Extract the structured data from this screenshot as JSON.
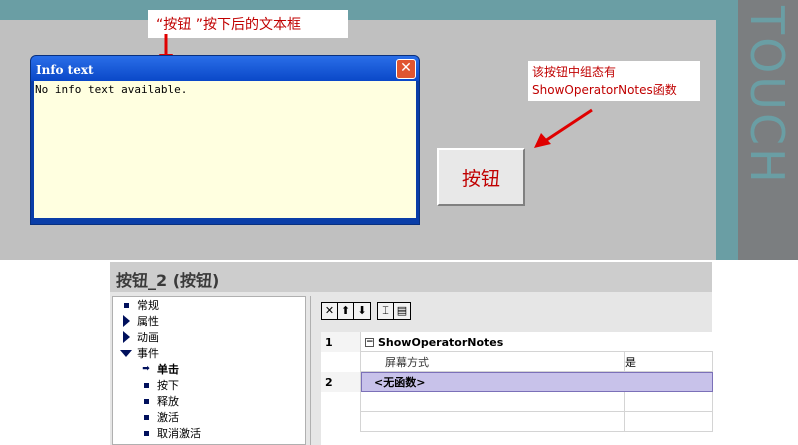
{
  "hmi": {
    "side_label": "TOUCH",
    "callout_top": "“按钮 ”按下后的文本框",
    "callout_right_line1": "该按钮中组态有",
    "callout_right_line2": "ShowOperatorNotes函数",
    "info_window": {
      "title": "Info text",
      "close_glyph": "✕",
      "body_text": "No info text available."
    },
    "button_label": "按钮"
  },
  "properties": {
    "header": "按钮_2 (按钮)",
    "tree": [
      {
        "label": "常规",
        "icon": "bullet-icon"
      },
      {
        "label": "属性",
        "icon": "expand-right-icon"
      },
      {
        "label": "动画",
        "icon": "expand-right-icon"
      },
      {
        "label": "事件",
        "icon": "expand-down-icon"
      },
      {
        "label": "单击",
        "icon": "arrow-right-icon"
      },
      {
        "label": "按下",
        "icon": "bullet-icon"
      },
      {
        "label": "释放",
        "icon": "bullet-icon"
      },
      {
        "label": "激活",
        "icon": "bullet-icon"
      },
      {
        "label": "取消激活",
        "icon": "bullet-icon"
      }
    ],
    "toolbar": [
      "✕",
      "⬆",
      "⬇",
      "⌶",
      "▤"
    ],
    "grid": {
      "row1": {
        "num": "1",
        "function": "ShowOperatorNotes"
      },
      "row1_param": {
        "label": "屏幕方式",
        "value": "是"
      },
      "row2": {
        "num": "2",
        "function": "<无函数>"
      }
    }
  },
  "colors": {
    "frame": "#6a9ea4",
    "screen": "#c0c0c0",
    "accent_red": "#e00000",
    "selection": "#c8c2ea"
  }
}
